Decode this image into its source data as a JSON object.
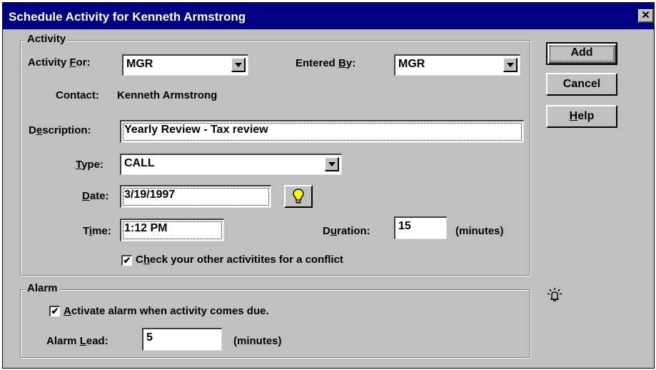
{
  "window": {
    "title": "Schedule Activity for Kenneth Armstrong",
    "close_glyph": "✕"
  },
  "activity": {
    "legend": "Activity",
    "activity_for_label": "Activity For:",
    "activity_for_value": "MGR",
    "entered_by_label": "Entered By:",
    "entered_by_value": "MGR",
    "contact_label": "Contact:",
    "contact_value": "Kenneth Armstrong",
    "description_label": "Description:",
    "description_value": "Yearly Review - Tax review",
    "type_label": "Type:",
    "type_value": "CALL",
    "date_label": "Date:",
    "date_value": "3/19/1997",
    "time_label": "Time:",
    "time_value": "1:12 PM",
    "duration_label": "Duration:",
    "duration_value": "15",
    "duration_unit": "(minutes)",
    "conflict_check_label": "Check your other activitites for a conflict",
    "conflict_checked": true
  },
  "alarm": {
    "legend": "Alarm",
    "activate_label": "Activate alarm when activity comes due.",
    "activate_checked": true,
    "lead_label": "Alarm Lead:",
    "lead_value": "5",
    "lead_unit": "(minutes)"
  },
  "buttons": {
    "add": "Add",
    "cancel": "Cancel",
    "help": "Help"
  },
  "icons": {
    "date_picker": "lightbulb-icon",
    "alarm": "alarm-bell-icon"
  }
}
